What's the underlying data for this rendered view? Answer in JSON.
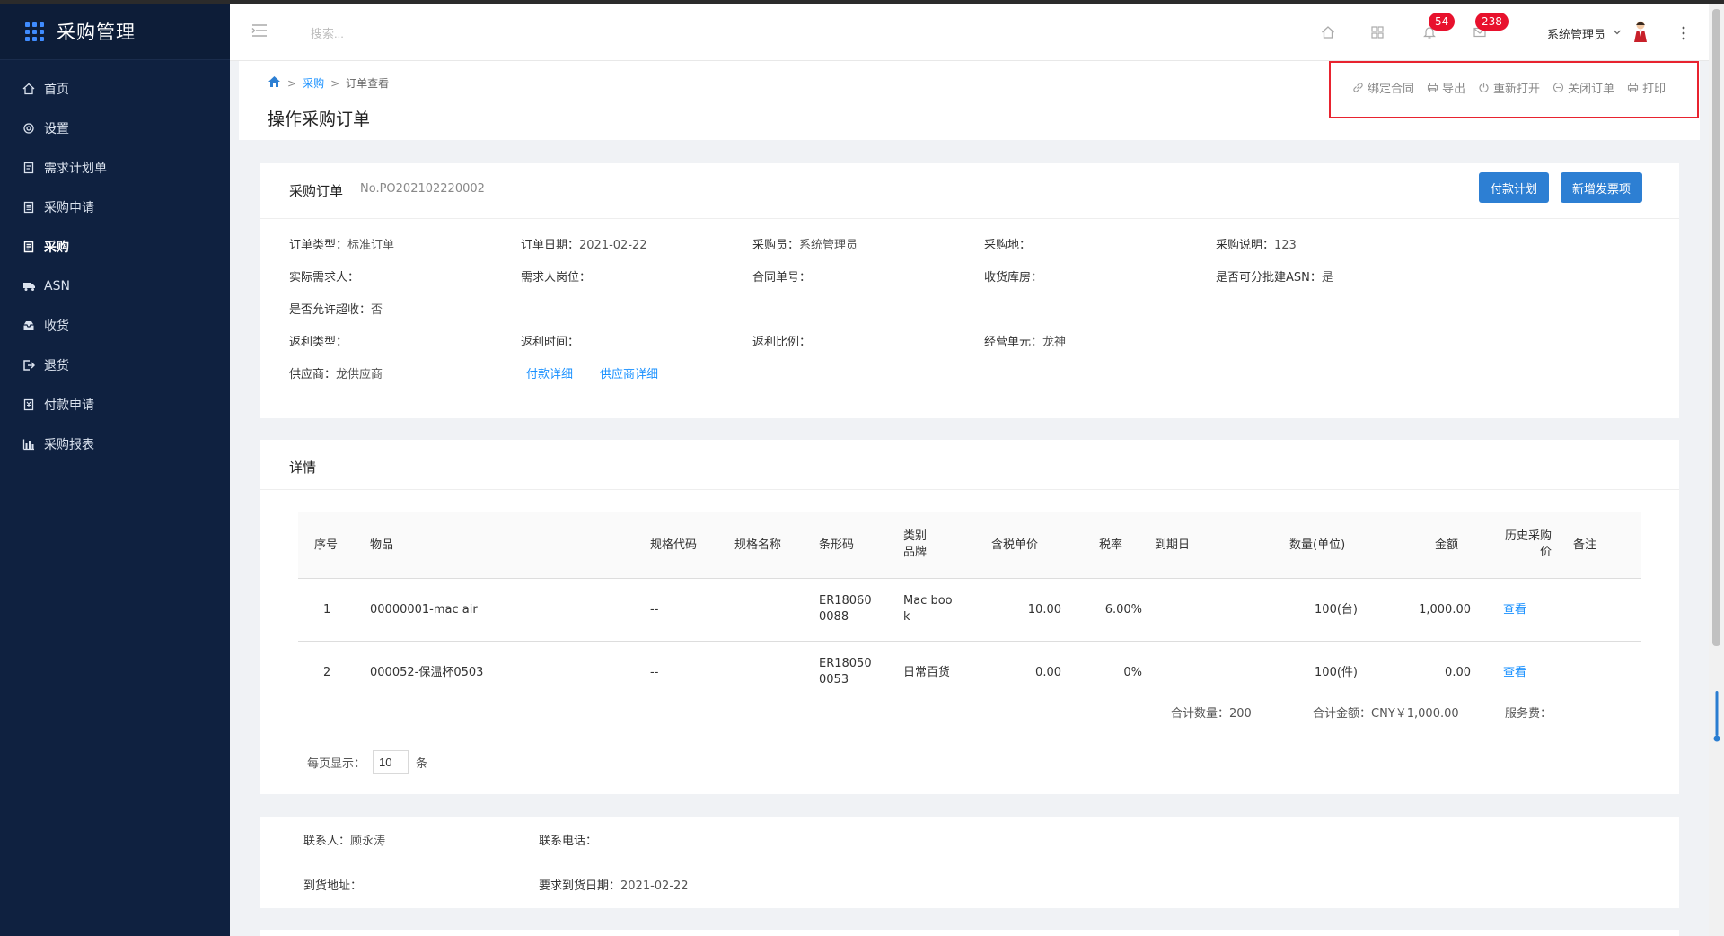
{
  "app": {
    "title": "采购管理"
  },
  "sidebar": {
    "items": [
      {
        "label": "首页",
        "icon": "home-icon"
      },
      {
        "label": "设置",
        "icon": "gear-icon"
      },
      {
        "label": "需求计划单",
        "icon": "document-icon"
      },
      {
        "label": "采购申请",
        "icon": "list-icon"
      },
      {
        "label": "采购",
        "icon": "clipboard-icon",
        "active": true
      },
      {
        "label": "ASN",
        "icon": "truck-icon"
      },
      {
        "label": "收货",
        "icon": "inbox-icon"
      },
      {
        "label": "退货",
        "icon": "return-icon"
      },
      {
        "label": "付款申请",
        "icon": "payment-icon"
      },
      {
        "label": "采购报表",
        "icon": "chart-icon"
      }
    ]
  },
  "header": {
    "search_placeholder": "搜索...",
    "notification_count": "54",
    "message_count": "238",
    "user_name": "系统管理员"
  },
  "breadcrumb": {
    "home_icon": "home-icon",
    "level1": "采购",
    "level2": "订单查看",
    "sep": ">"
  },
  "page": {
    "title": "操作采购订单"
  },
  "actions": [
    {
      "label": "绑定合同",
      "icon": "link-icon"
    },
    {
      "label": "导出",
      "icon": "printer-icon"
    },
    {
      "label": "重新打开",
      "icon": "power-icon"
    },
    {
      "label": "关闭订单",
      "icon": "minus-circle-icon"
    },
    {
      "label": "打印",
      "icon": "printer-icon"
    }
  ],
  "order": {
    "title": "采购订单",
    "number": "No.PO202102220002",
    "btn_payment_plan": "付款计划",
    "btn_add_invoice": "新增发票项",
    "fields": {
      "order_type_label": "订单类型：",
      "order_type": "标准订单",
      "order_date_label": "订单日期：",
      "order_date": "2021-02-22",
      "buyer_label": "采购员：",
      "buyer": "系统管理员",
      "purchase_place_label": "采购地：",
      "purchase_place": "",
      "purchase_note_label": "采购说明：",
      "purchase_note": "123",
      "actual_requester_label": "实际需求人：",
      "actual_requester": "",
      "requester_post_label": "需求人岗位：",
      "requester_post": "",
      "contract_no_label": "合同单号：",
      "contract_no": "",
      "warehouse_label": "收货库房：",
      "warehouse": "",
      "batch_asn_label": "是否可分批建ASN：",
      "batch_asn": "是",
      "over_receive_label": "是否允许超收：",
      "over_receive": "否",
      "rebate_type_label": "返利类型：",
      "rebate_type": "",
      "rebate_time_label": "返利时间：",
      "rebate_time": "",
      "rebate_ratio_label": "返利比例：",
      "rebate_ratio": "",
      "business_unit_label": "经营单元：",
      "business_unit": "龙神",
      "supplier_label": "供应商：",
      "supplier": "龙供应商"
    },
    "link_payment_detail": "付款详细",
    "link_supplier_detail": "供应商详细"
  },
  "detail": {
    "title": "详情",
    "columns": {
      "seq": "序号",
      "item": "物品",
      "spec_code": "规格代码",
      "spec_name": "规格名称",
      "barcode": "条形码",
      "category_l1": "类别",
      "category_l2": "品牌",
      "unit_price": "含税单价",
      "tax_rate": "税率",
      "due_date": "到期日",
      "quantity": "数量(单位)",
      "amount": "金额",
      "history_l1": "历史采购",
      "history_l2": "价",
      "remark": "备注"
    },
    "rows": [
      {
        "seq": "1",
        "item": "00000001-mac air",
        "spec_code": "--",
        "barcode_l1": "ER18060",
        "barcode_l2": "0088",
        "category_l1": "Mac boo",
        "category_l2": "k",
        "unit_price": "10.00",
        "tax_rate": "6.00%",
        "quantity": "100(台)",
        "amount": "1,000.00",
        "history": "查看"
      },
      {
        "seq": "2",
        "item": "000052-保温杯0503",
        "spec_code": "--",
        "barcode_l1": "ER18050",
        "barcode_l2": "0053",
        "category_l1": "日常百货",
        "category_l2": "",
        "unit_price": "0.00",
        "tax_rate": "0%",
        "quantity": "100(件)",
        "amount": "0.00",
        "history": "查看"
      }
    ],
    "summary": {
      "total_qty_label": "合计数量：",
      "total_qty": "200",
      "total_amount_label": "合计金额：",
      "total_amount": "CNY￥1,000.00",
      "service_fee_label": "服务费：",
      "service_fee": ""
    },
    "pager": {
      "label": "每页显示：",
      "value": "10",
      "unit": "条"
    }
  },
  "contact": {
    "person_label": "联系人：",
    "person": "顾永涛",
    "phone_label": "联系电话：",
    "phone": "",
    "address_label": "到货地址：",
    "address": "",
    "required_date_label": "要求到货日期：",
    "required_date": "2021-02-22"
  },
  "colors": {
    "sidebar_bg": "#0f2140",
    "primary": "#2d7fd3",
    "link": "#1890ff",
    "badge": "#e8112d",
    "highlight_box": "#e8232f"
  }
}
